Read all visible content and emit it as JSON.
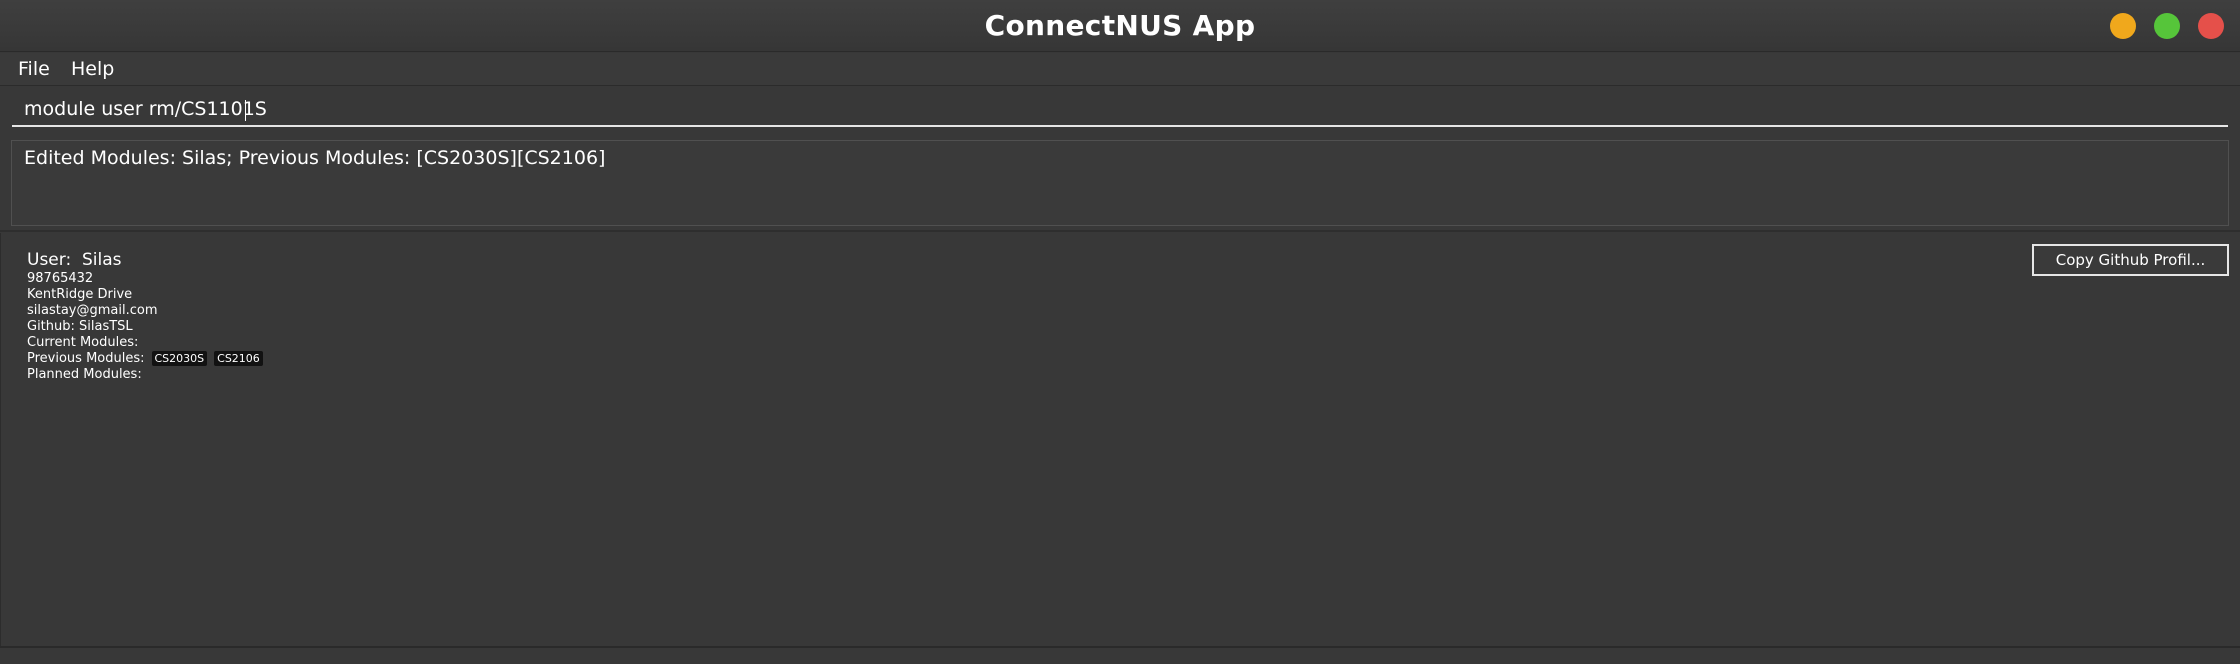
{
  "window": {
    "title": "ConnectNUS App",
    "controls": {
      "minimize_color": "#f0a81c",
      "maximize_color": "#56c53a",
      "close_color": "#e5504a"
    }
  },
  "menu": {
    "items": [
      {
        "label": "File"
      },
      {
        "label": "Help"
      }
    ]
  },
  "command_box": {
    "value": "module user rm/CS1101S"
  },
  "result_display": {
    "text": "Edited Modules: Silas; Previous Modules: [CS2030S][CS2106]"
  },
  "user_card": {
    "name_line": "User:  Silas",
    "phone": "98765432",
    "address": "KentRidge Drive",
    "email": "silastay@gmail.com",
    "github": "Github: SilasTSL",
    "current_modules_label": "Current Modules:",
    "previous_modules_label": "Previous Modules:",
    "previous_modules": [
      "CS2030S",
      "CS2106"
    ],
    "planned_modules_label": "Planned Modules:",
    "copy_button_label": "Copy Github Profil..."
  }
}
